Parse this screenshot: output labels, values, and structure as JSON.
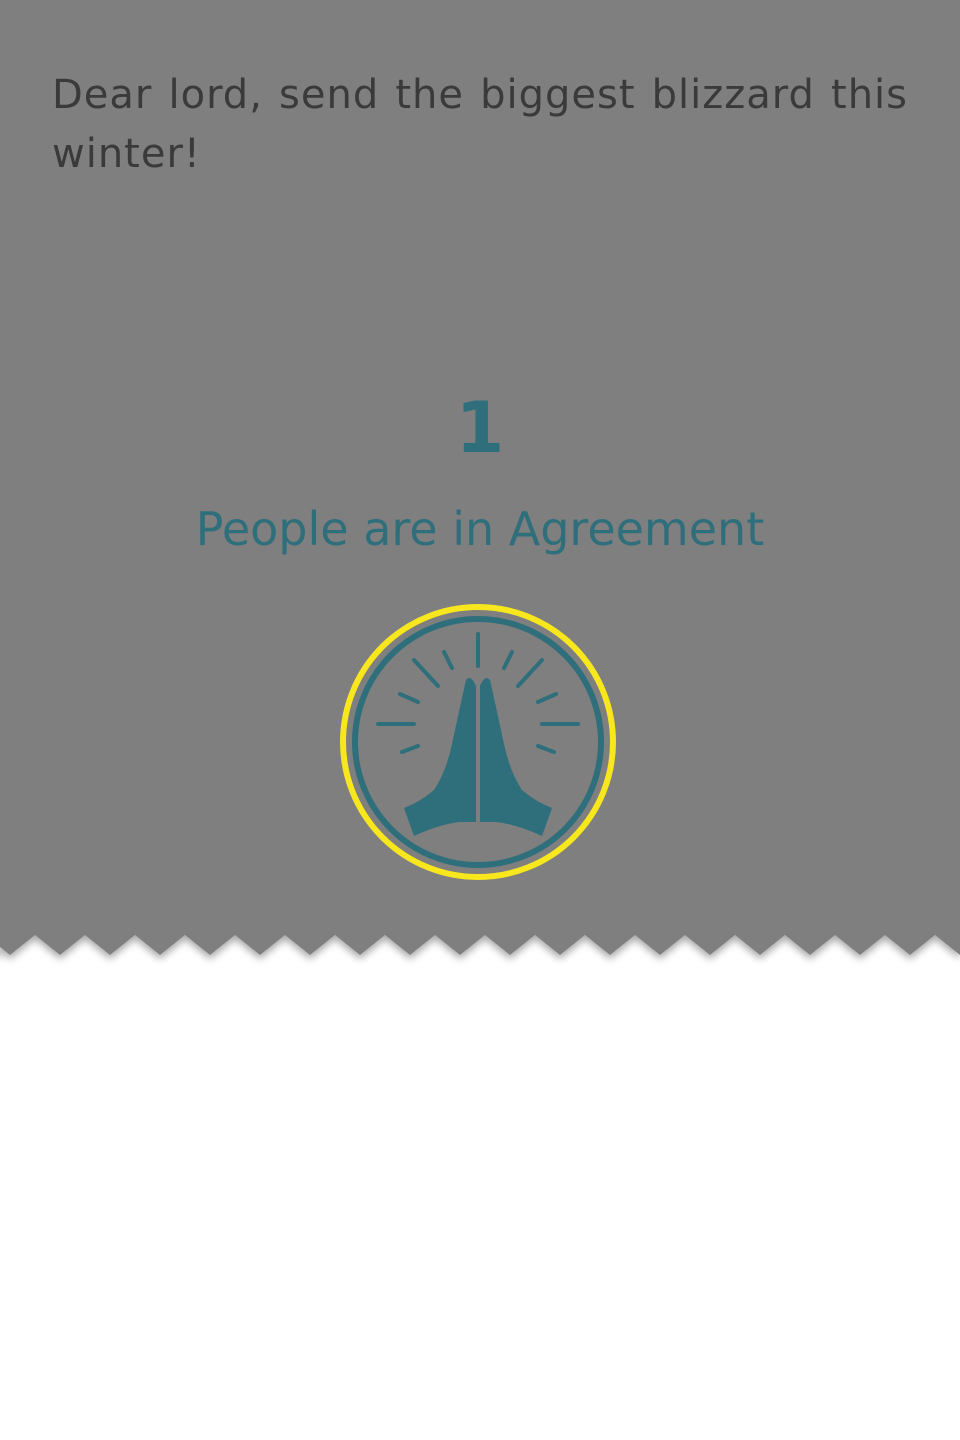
{
  "prayer": {
    "text": "Dear lord, send the biggest blizzard this winter!"
  },
  "agreement": {
    "count": "1",
    "label": "People are in Agreement"
  },
  "pray_button": {
    "icon": "praying-hands-icon"
  },
  "colors": {
    "card_background": "#7f7f7f",
    "accent": "#2e6f7b",
    "highlight_ring": "#f8e71c",
    "text": "#3a3a3a",
    "page_background": "#ffffff"
  }
}
